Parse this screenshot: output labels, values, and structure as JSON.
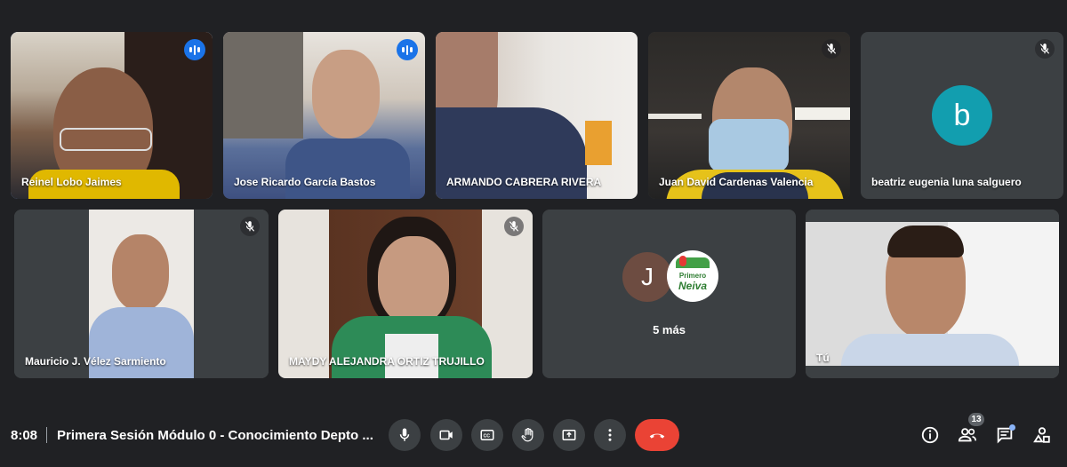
{
  "participants": [
    {
      "name": "Reinel Lobo Jaimes",
      "status": "speaking"
    },
    {
      "name": "Jose Ricardo García Bastos",
      "status": "speaking"
    },
    {
      "name": "ARMANDO CABRERA RIVERA",
      "status": "none"
    },
    {
      "name": "Juan David Cardenas Valencia",
      "status": "muted"
    },
    {
      "name": "beatriz eugenia luna salguero",
      "status": "muted",
      "avatar_letter": "b",
      "avatar_color": "#129eaf"
    },
    {
      "name": "Mauricio J. Vélez Sarmiento",
      "status": "muted"
    },
    {
      "name": "MAYDY ALEJANDRA ORTIZ TRUJILLO",
      "status": "muted"
    },
    {
      "name": "Tú",
      "status": "none"
    }
  ],
  "more_tile": {
    "avatar_letter": "J",
    "avatar_color": "#6d4c41",
    "logo_text_top": "Primero",
    "logo_text_bottom": "Neiva",
    "label": "5 más"
  },
  "bottom_bar": {
    "time": "8:08",
    "meeting_title": "Primera Sesión Módulo 0 - Conocimiento Depto ...",
    "people_count": "13",
    "controls": [
      "microphone-icon",
      "camera-icon",
      "captions-icon",
      "raise-hand-icon",
      "present-icon",
      "more-options-icon"
    ],
    "end_call_color": "#ea4335",
    "right_icons": [
      "info-icon",
      "people-icon",
      "chat-icon",
      "activities-icon"
    ]
  }
}
